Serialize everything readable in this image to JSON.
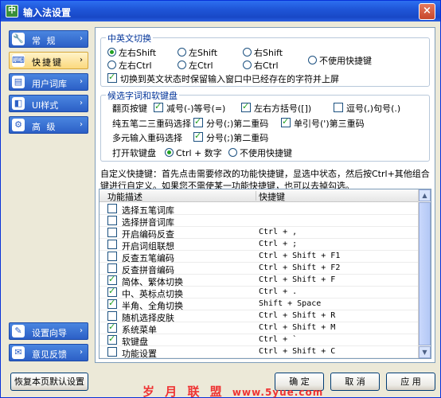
{
  "window": {
    "title": "输入法设置",
    "close_glyph": "×"
  },
  "sidebar": {
    "items": [
      {
        "label": "常 规",
        "icon": "wrench-icon",
        "glyph": "🔧"
      },
      {
        "label": "快捷键",
        "icon": "keyboard-icon",
        "glyph": "⌨"
      },
      {
        "label": "用户词库",
        "icon": "book-icon",
        "glyph": "▤"
      },
      {
        "label": "UI样式",
        "icon": "palette-icon",
        "glyph": "◧"
      },
      {
        "label": "高 级",
        "icon": "gear-icon",
        "glyph": "⚙"
      }
    ],
    "bottom": [
      {
        "label": "设置向导",
        "icon": "wizard-icon",
        "glyph": "✎"
      },
      {
        "label": "意见反馈",
        "icon": "feedback-icon",
        "glyph": "✉"
      }
    ]
  },
  "switch_group": {
    "title": "中英文切换",
    "options": [
      "左右Shift",
      "左Shift",
      "右Shift",
      "左右Ctrl",
      "左Ctrl",
      "右Ctrl",
      "不使用快捷键"
    ],
    "selected": "左右Shift",
    "keep_text_label": "切换到英文状态时保留输入窗口中已经存在的字符并上屏",
    "keep_text_checked": true
  },
  "candidate_group": {
    "title": "候选字词和软键盘",
    "paging_label": "翻页按键",
    "paging_opts": [
      {
        "label": "减号(-)等号(=)",
        "checked": true
      },
      {
        "label": "左右方括号([])",
        "checked": true
      },
      {
        "label": "逗号(,)句号(.)",
        "checked": false
      }
    ],
    "pure_label": "纯五笔二三重码选择",
    "pure_opts": [
      {
        "label": "分号(;)第二重码",
        "checked": true
      },
      {
        "label": "单引号(')第三重码",
        "checked": true
      }
    ],
    "multi_label": "多元输入重码选择",
    "multi_opts": [
      {
        "label": "分号(;)第二重码",
        "checked": true
      }
    ],
    "softkb_label": "打开软键盘",
    "softkb_opts": [
      "Ctrl + 数字",
      "不使用快捷键"
    ],
    "softkb_selected": "Ctrl + 数字"
  },
  "custom_desc": "自定义快捷键：首先点击需要修改的功能快捷键，显选中状态，然后按Ctrl+其他组合键进行自定义。如果您不需使某一功能快捷键，也可以去掉勾选。",
  "table": {
    "headers": [
      "功能描述",
      "快捷键"
    ],
    "rows": [
      {
        "fn": "选择五笔词库",
        "key": "",
        "checked": false
      },
      {
        "fn": "选择拼音词库",
        "key": "",
        "checked": false
      },
      {
        "fn": "开启编码反查",
        "key": "Ctrl + ,",
        "checked": false
      },
      {
        "fn": "开启词组联想",
        "key": "Ctrl + ;",
        "checked": false
      },
      {
        "fn": "反查五笔编码",
        "key": "Ctrl + Shift + F1",
        "checked": false
      },
      {
        "fn": "反查拼音编码",
        "key": "Ctrl + Shift + F2",
        "checked": false
      },
      {
        "fn": "简体、繁体切换",
        "key": "Ctrl + Shift + F",
        "checked": true
      },
      {
        "fn": "中、英标点切换",
        "key": "Ctrl + .",
        "checked": true
      },
      {
        "fn": "半角、全角切换",
        "key": "Shift + Space",
        "checked": true
      },
      {
        "fn": "随机选择皮肤",
        "key": "Ctrl + Shift + R",
        "checked": false
      },
      {
        "fn": "系统菜单",
        "key": "Ctrl + Shift + M",
        "checked": true
      },
      {
        "fn": "软键盘",
        "key": "Ctrl + `",
        "checked": true
      },
      {
        "fn": "功能设置",
        "key": "Ctrl + Shift + C",
        "checked": false
      }
    ]
  },
  "buttons": {
    "restore": "恢复本页默认设置",
    "ok": "确 定",
    "cancel": "取 消",
    "apply": "应 用"
  },
  "watermark": {
    "text": "岁 月 联 盟",
    "url": "www.5yue.com"
  }
}
